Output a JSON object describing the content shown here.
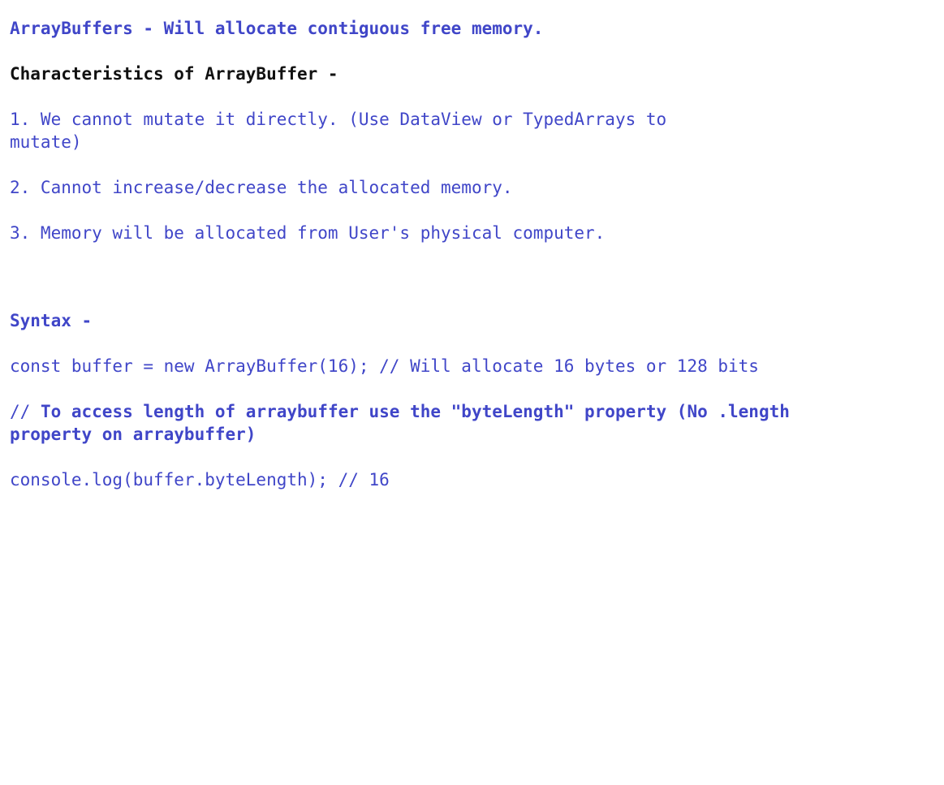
{
  "colors": {
    "text": "#4046c8",
    "heading": "#111111",
    "background": "#ffffff"
  },
  "document": {
    "title": "ArrayBuffers - Will allocate contiguous free memory.",
    "characteristics_heading": "Characteristics of ArrayBuffer -",
    "points": [
      "1. We cannot mutate it directly. (Use DataView or TypedArrays to mutate)",
      "2. Cannot increase/decrease the allocated memory.",
      "3. Memory will be allocated from User's physical computer."
    ],
    "syntax_heading": "Syntax -",
    "code_line_1": "const buffer = new ArrayBuffer(16); // Will allocate 16 bytes or 128 bits",
    "comment_prefix": "// ",
    "comment_text": "To access length of arraybuffer use the \"byteLength\" property (No .length property on arraybuffer)",
    "code_line_2": "console.log(buffer.byteLength); // 16"
  }
}
